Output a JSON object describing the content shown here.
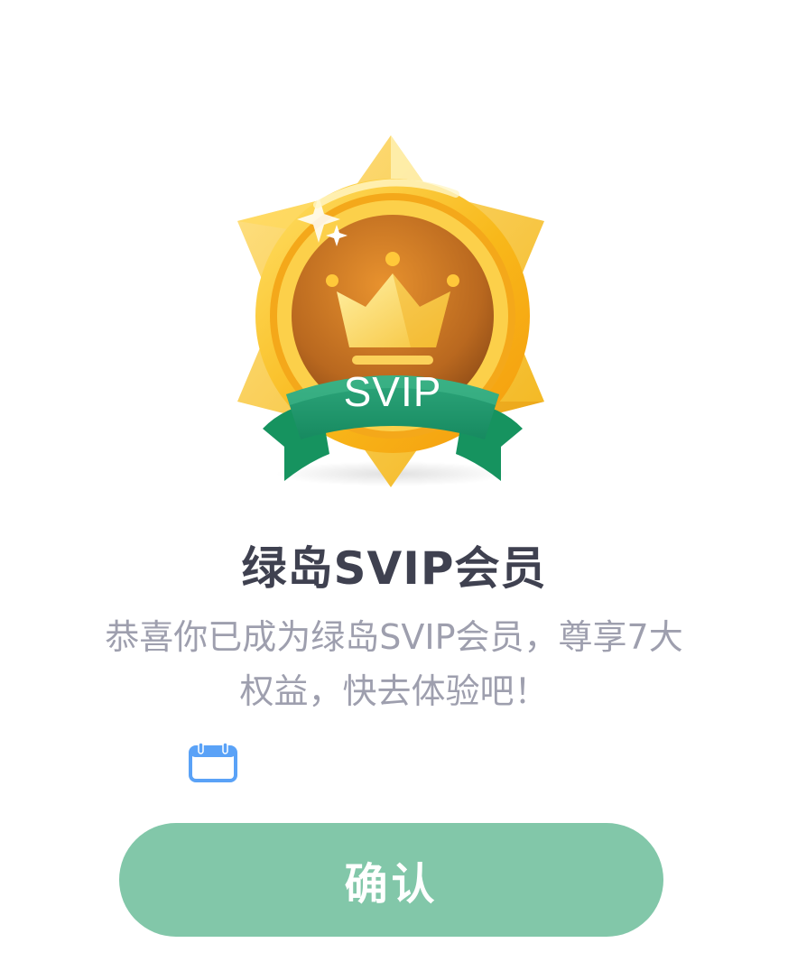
{
  "badge": {
    "ribbon_text": "SVIP",
    "icon": "svip-crown-medal-icon"
  },
  "title": "绿岛SVIP会员",
  "description": "恭喜你已成为绿岛SVIP会员，尊享7大权益，快去体验吧！",
  "validity": {
    "icon": "calendar-icon",
    "text": ""
  },
  "confirm_button": {
    "label": "确认"
  },
  "colors": {
    "button": "#82c7a9",
    "title": "#3f4150",
    "text": "#9e9fae",
    "ribbon": "#1c9a6e",
    "gold": "#f6c02a",
    "calendar": "#5aa2f7"
  }
}
